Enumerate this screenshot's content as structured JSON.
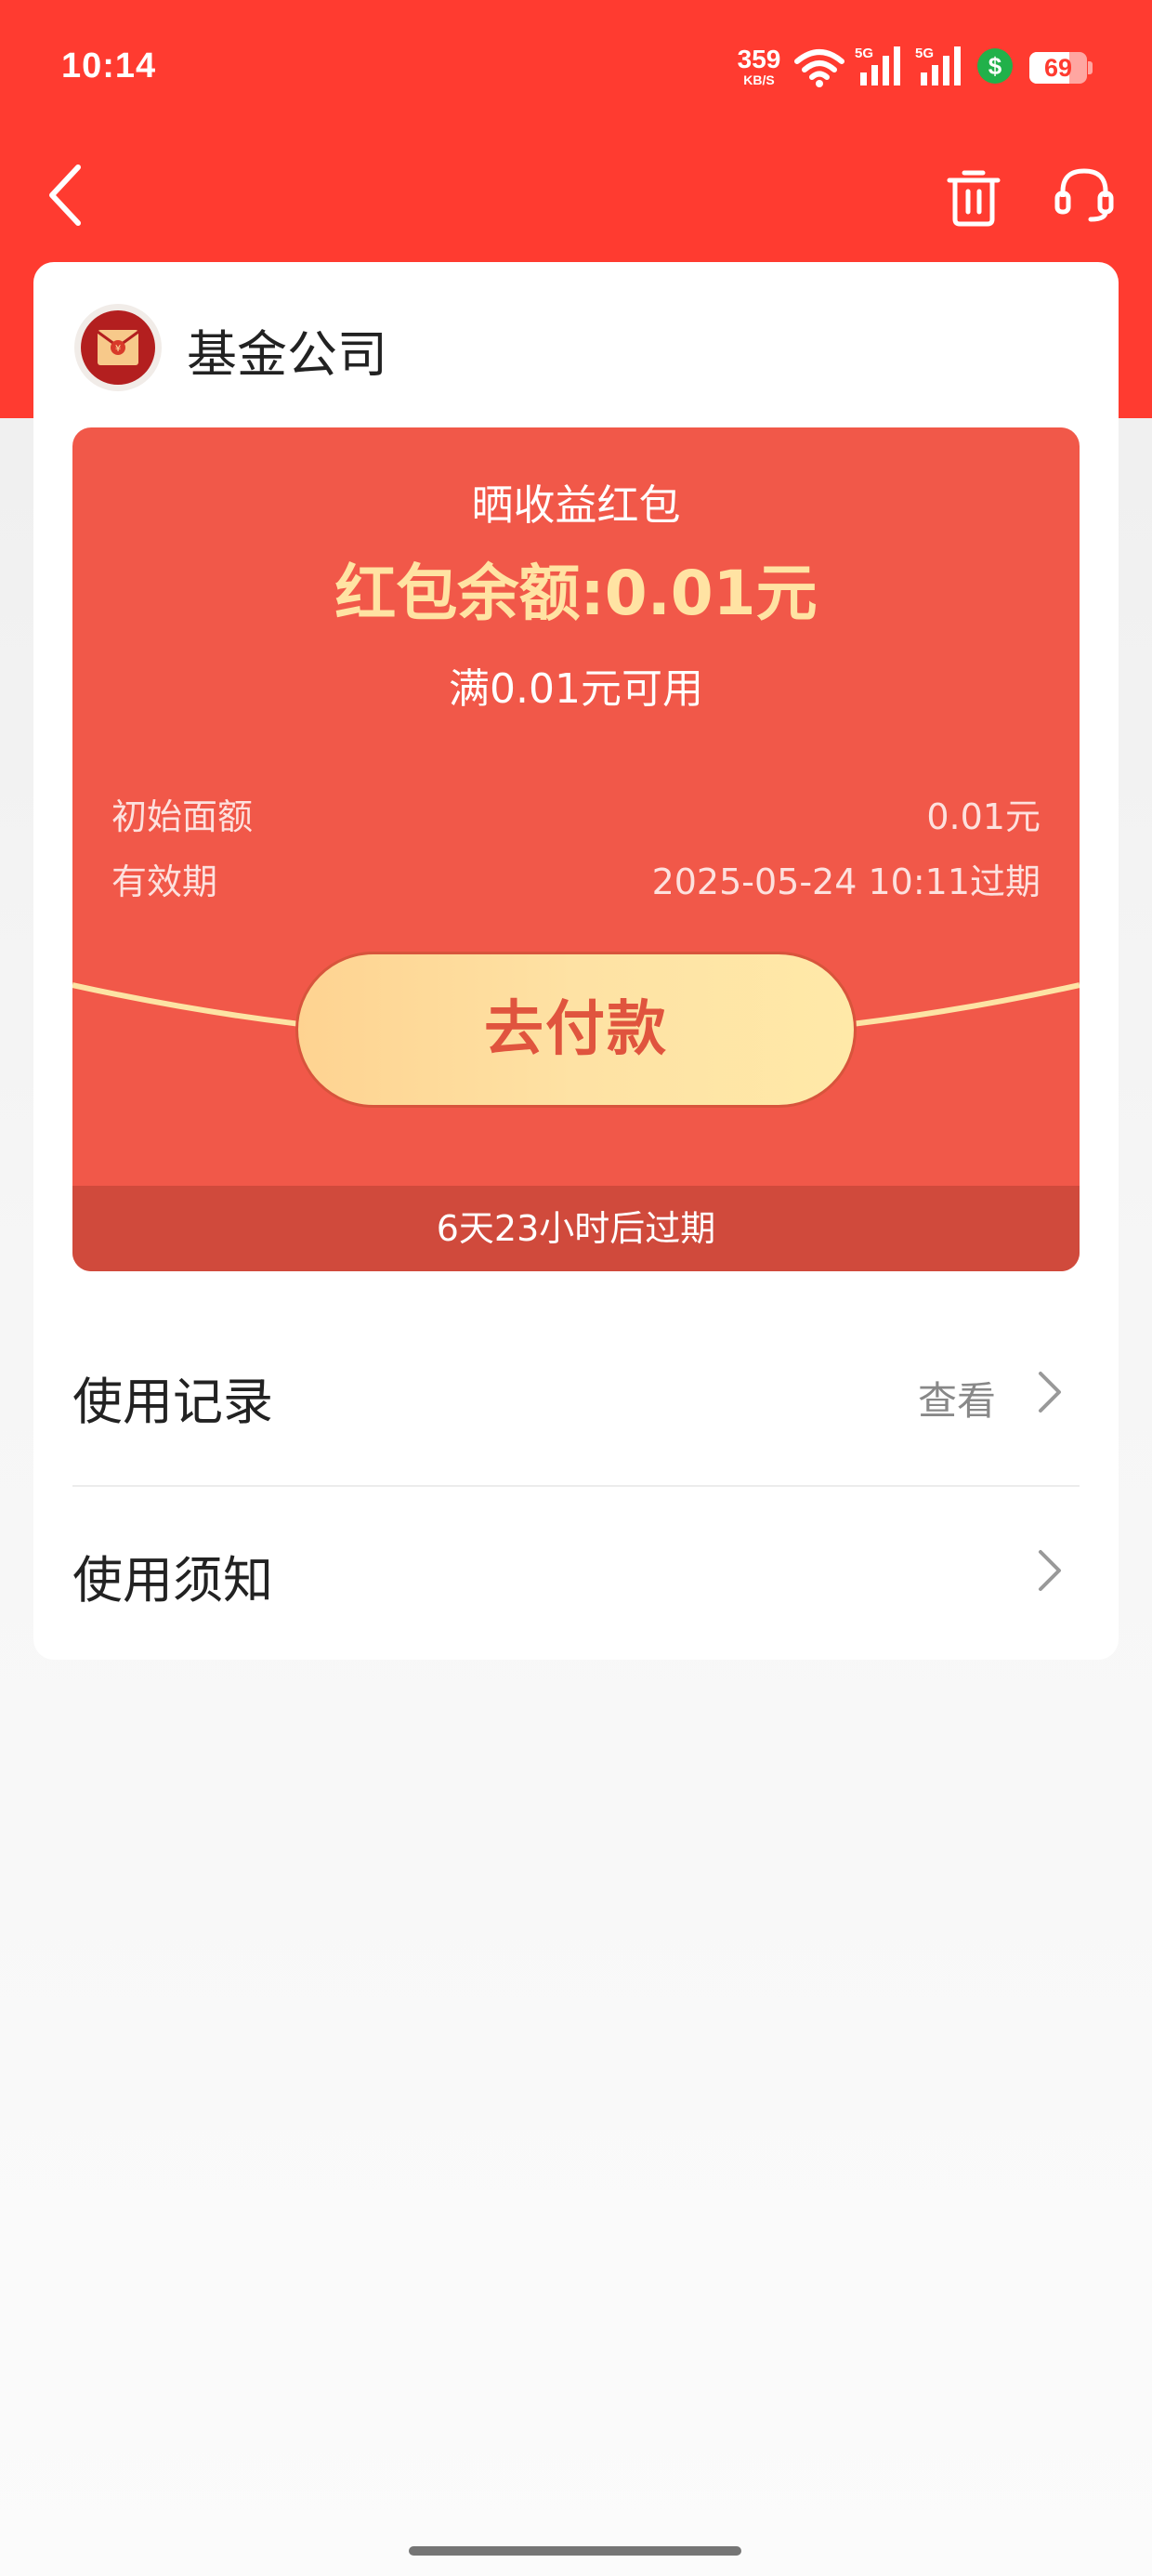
{
  "status_bar": {
    "time": "10:14",
    "net_speed": "359",
    "net_speed_unit": "KB/S",
    "signal_1_label": "5G",
    "signal_2_label": "5G",
    "battery_level": 69,
    "battery_text": "69",
    "icons": [
      "wifi-icon",
      "signal-icon",
      "signal-icon",
      "dollar-icon",
      "battery-icon"
    ],
    "accent_color": "#ff3b30"
  },
  "nav": {
    "back_icon": "chevron-left-icon",
    "delete_icon": "trash-icon",
    "support_icon": "headset-icon"
  },
  "brand": {
    "name": "基金公司",
    "logo_icon": "red-envelope-icon"
  },
  "coupon": {
    "title": "晒收益红包",
    "balance_text": "红包余额:0.01元",
    "threshold_text": "满0.01元可用",
    "details": [
      {
        "label": "初始面额",
        "value": "0.01元"
      },
      {
        "label": "有效期",
        "value": "2025-05-24 10:11过期"
      }
    ],
    "pay_button_label": "去付款",
    "expiry_notice": "6天23小时后过期",
    "colors": {
      "card": "#f15849",
      "footer": "#d04a3c",
      "balance": "#ffe3a3",
      "button": "#fee2a4"
    }
  },
  "menu": {
    "records": {
      "label": "使用记录",
      "action": "查看"
    },
    "notice": {
      "label": "使用须知"
    }
  }
}
